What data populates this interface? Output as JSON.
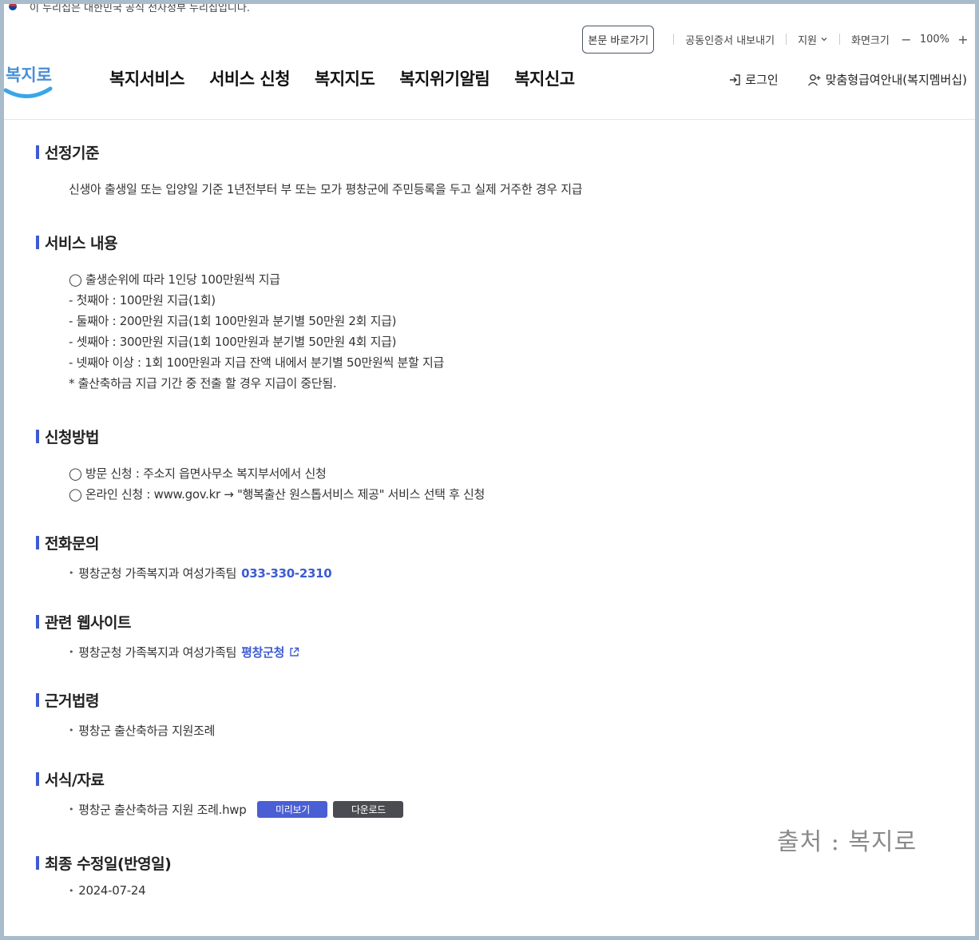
{
  "gov_banner": {
    "text": "이 누리집은 대한민국 공식 전자정부 누리집입니다."
  },
  "utility": {
    "skip_label": "본문 바로가기",
    "cert_label": "공동인증서 내보내기",
    "support_label": "지원",
    "screen_size_label": "화면크기",
    "zoom_minus": "−",
    "zoom_value": "100%",
    "zoom_plus": "+"
  },
  "logo": {
    "text": "복지로"
  },
  "nav": {
    "items": [
      "복지서비스",
      "서비스 신청",
      "복지지도",
      "복지위기알림",
      "복지신고"
    ]
  },
  "header_right": {
    "login": "로그인",
    "membership": "맞춤형급여안내(복지멤버십)"
  },
  "sections": {
    "criteria": {
      "title": "선정기준",
      "text": "신생아 출생일 또는 입양일 기준 1년전부터 부 또는 모가 평창군에 주민등록을 두고 실제 거주한 경우 지급"
    },
    "service": {
      "title": "서비스 내용",
      "lines": [
        "◯ 출생순위에 따라 1인당 100만원씩 지급",
        "- 첫째아 : 100만원 지급(1회)",
        "- 둘째아 : 200만원 지급(1회 100만원과 분기별 50만원 2회 지급)",
        "- 셋째아 : 300만원 지급(1회 100만원과 분기별 50만원 4회 지급)",
        "- 넷째아 이상 : 1회 100만원과 지급 잔액 내에서 분기별 50만원씩 분할 지급",
        "* 출산축하금 지급 기간 중 전출 할 경우 지급이 중단됨."
      ]
    },
    "apply": {
      "title": "신청방법",
      "lines": [
        "◯ 방문 신청 : 주소지 읍면사무소 복지부서에서 신청",
        "◯ 온라인 신청 : www.gov.kr → \"행복출산 원스톱서비스 제공\" 서비스 선택 후 신청"
      ]
    },
    "phone": {
      "title": "전화문의",
      "dept": "평창군청 가족복지과 여성가족팀",
      "number": "033-330-2310"
    },
    "site": {
      "title": "관련 웹사이트",
      "dept": "평창군청 가족복지과 여성가족팀",
      "link": "평창군청"
    },
    "law": {
      "title": "근거법령",
      "item": "평창군 출산축하금 지원조례"
    },
    "forms": {
      "title": "서식/자료",
      "file": "평창군 출산축하금 지원 조례.hwp",
      "preview": "미리보기",
      "download": "다운로드"
    },
    "updated": {
      "title": "최종 수정일(반영일)",
      "date": "2024-07-24"
    }
  },
  "watermark": {
    "text": "출처 : 복지로"
  }
}
